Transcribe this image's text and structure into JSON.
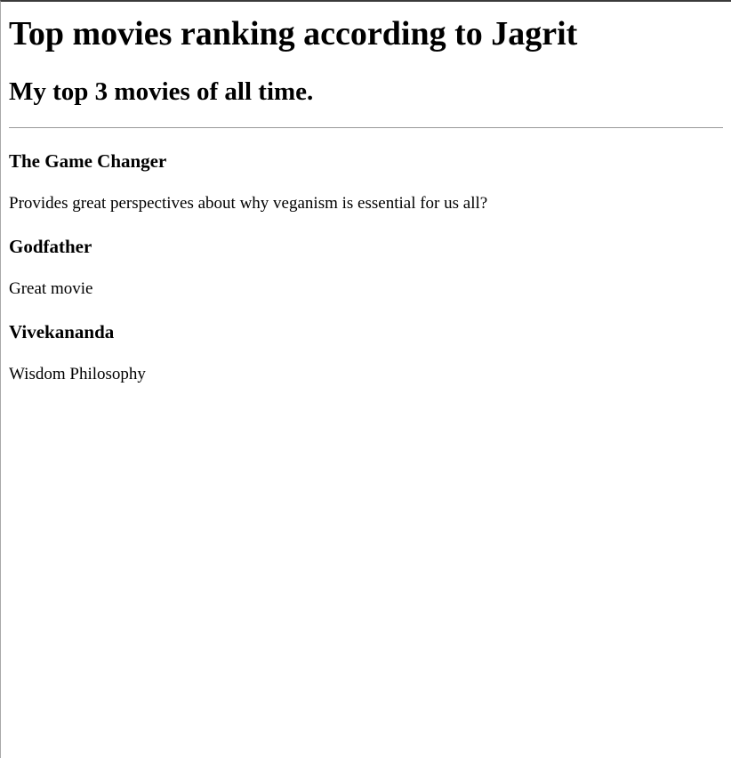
{
  "page": {
    "title": "Top movies ranking according to Jagrit",
    "subtitle": "My top 3 movies of all time."
  },
  "movies": [
    {
      "title": "The Game Changer",
      "description": "Provides great perspectives about why veganism is essential for us all?"
    },
    {
      "title": "Godfather",
      "description": "Great movie"
    },
    {
      "title": "Vivekananda",
      "description": "Wisdom Philosophy"
    }
  ]
}
